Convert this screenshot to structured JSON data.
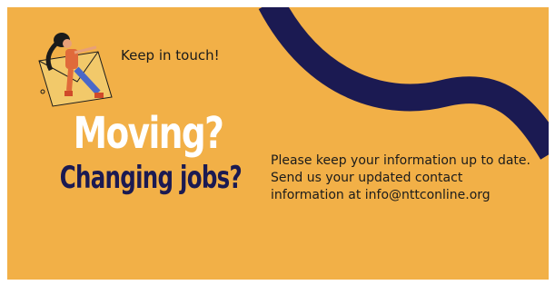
{
  "card": {
    "tagline": "Keep in touch!",
    "headline": "Moving?",
    "subheadline": "Changing jobs?",
    "message_lines": [
      "Please keep your information up to date.",
      "Send us your updated contact",
      "information at info@nttconline.org"
    ]
  },
  "icons": {
    "illustration": "woman-with-envelope-icon",
    "decoration": "wave-ribbon-icon"
  },
  "colors": {
    "background": "#f2b047",
    "ribbon": "#1b1a52",
    "headline": "#ffffff",
    "subheadline": "#1b1a52",
    "text": "#1b1b1b"
  }
}
